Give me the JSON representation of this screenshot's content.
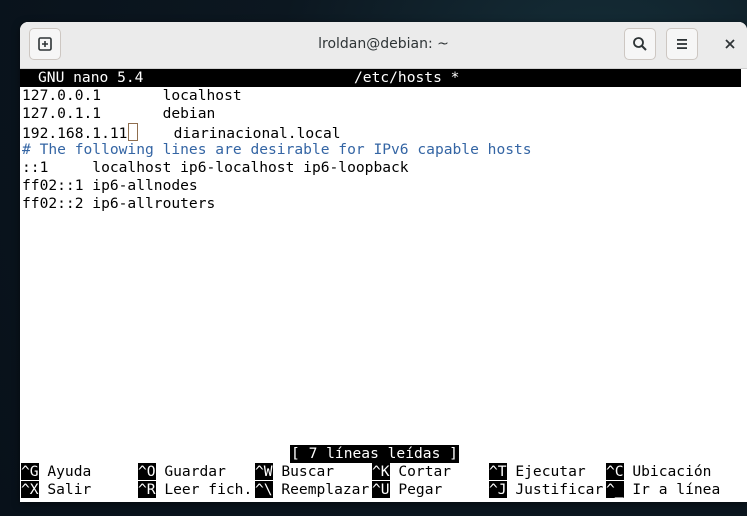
{
  "window": {
    "title": "lroldan@debian: ~"
  },
  "icons": {
    "new_tab": "new-tab-icon",
    "search": "search-icon",
    "menu": "hamburger-menu-icon",
    "close": "close-icon"
  },
  "nano": {
    "version": "GNU nano 5.4",
    "filename": "/etc/hosts *",
    "lines": [
      {
        "text": "127.0.0.1       localhost",
        "type": "normal"
      },
      {
        "text": "127.0.1.1       debian",
        "type": "normal"
      },
      {
        "text": "192.168.1.11",
        "after_cursor": "    diarinacional.local",
        "type": "cursor"
      },
      {
        "text": "# The following lines are desirable for IPv6 capable hosts",
        "type": "comment"
      },
      {
        "text": "::1     localhost ip6-localhost ip6-loopback",
        "type": "normal"
      },
      {
        "text": "ff02::1 ip6-allnodes",
        "type": "normal"
      },
      {
        "text": "ff02::2 ip6-allrouters",
        "type": "normal"
      }
    ],
    "status": "[ 7 líneas leídas ]",
    "shortcuts_row1": [
      {
        "key": "^G",
        "label": " Ayuda"
      },
      {
        "key": "^O",
        "label": " Guardar"
      },
      {
        "key": "^W",
        "label": " Buscar"
      },
      {
        "key": "^K",
        "label": " Cortar"
      },
      {
        "key": "^T",
        "label": " Ejecutar"
      },
      {
        "key": "^C",
        "label": " Ubicación"
      }
    ],
    "shortcuts_row2": [
      {
        "key": "^X",
        "label": " Salir"
      },
      {
        "key": "^R",
        "label": " Leer fich."
      },
      {
        "key": "^\\",
        "label": " Reemplazar"
      },
      {
        "key": "^U",
        "label": " Pegar"
      },
      {
        "key": "^J",
        "label": " Justificar"
      },
      {
        "key": "^_",
        "label": " Ir a línea"
      }
    ]
  }
}
